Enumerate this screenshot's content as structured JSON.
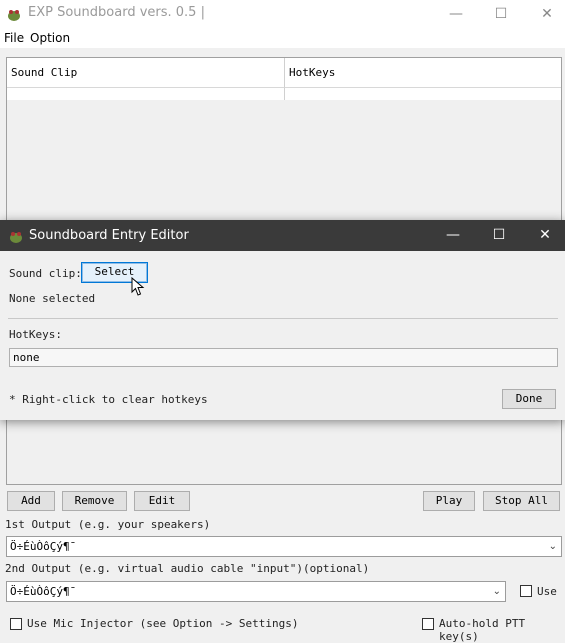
{
  "main": {
    "title": "EXP Soundboard vers. 0.5 |",
    "menu": [
      "File",
      "Option"
    ],
    "table": {
      "columns": [
        "Sound Clip",
        "HotKeys"
      ]
    },
    "buttons": {
      "add": "Add",
      "remove": "Remove",
      "edit": "Edit",
      "play": "Play",
      "stop_all": "Stop All"
    },
    "output1": {
      "label": "1st Output (e.g. your speakers)",
      "value": "Ö÷ÉùÒôÇý¶¯"
    },
    "output2": {
      "label": "2nd Output (e.g. virtual audio cable \"input\")(optional)",
      "value": "Ö÷ÉùÒôÇý¶¯",
      "use_label": "Use"
    },
    "mic_injector": {
      "label": "Use Mic Injector (see Option -> Settings)",
      "checked": false
    },
    "auto_hold": {
      "label": "Auto-hold PTT key(s)",
      "checked": false
    }
  },
  "dialog": {
    "title": "Soundboard Entry Editor",
    "sound_clip_label": "Sound clip:",
    "select_label": "Select",
    "status": "None selected",
    "hotkeys_label": "HotKeys:",
    "hotkeys_value": "none",
    "hint": "* Right-click to clear hotkeys",
    "done_label": "Done"
  },
  "icons": {
    "minimize": "minimize-icon",
    "maximize": "maximize-icon",
    "close": "close-icon",
    "app": "frog-app-icon",
    "dropdown": "chevron-down-icon"
  }
}
